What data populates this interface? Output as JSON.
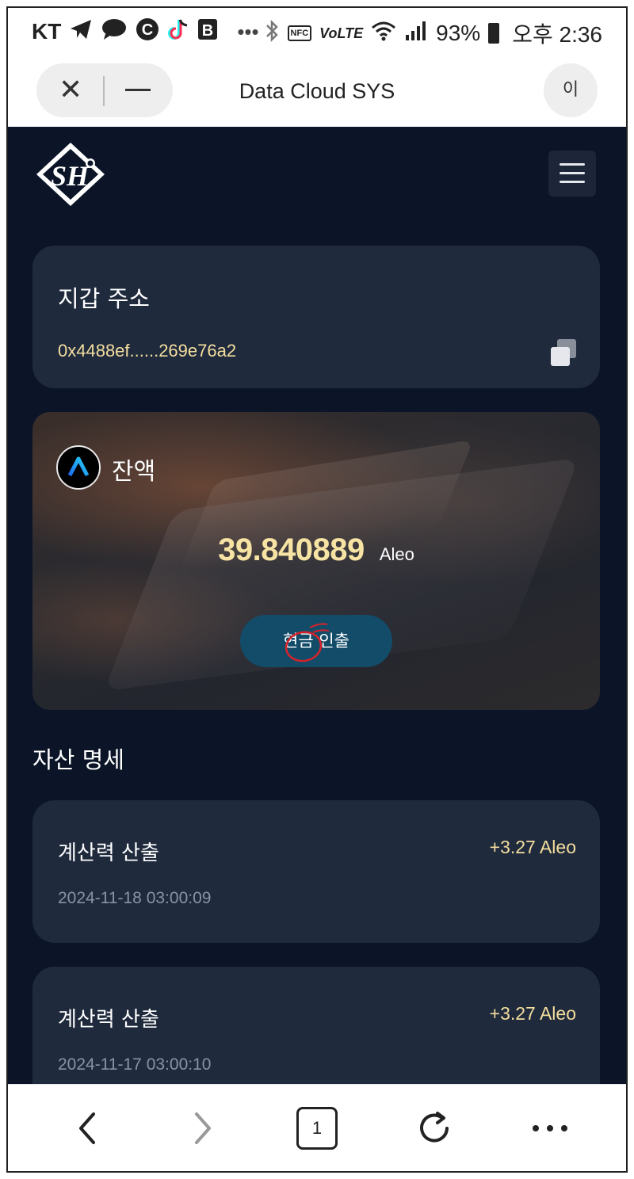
{
  "status_bar": {
    "carrier": "KT",
    "battery": "93%",
    "time": "오후 2:36",
    "icons": [
      "telegram-icon",
      "chat-icon",
      "c-app-icon",
      "tiktok-icon",
      "b-app-icon",
      "more-notifications-icon",
      "bluetooth-icon",
      "nfc-icon",
      "volte-icon",
      "wifi-icon",
      "signal-icon",
      "battery-icon"
    ],
    "nfc_label": "NFC",
    "volte_label": "VoLTE",
    "overflow": "•••"
  },
  "browser": {
    "title": "Data Cloud SYS",
    "profile_initial": "이"
  },
  "wallet": {
    "title": "지갑 주소",
    "address": "0x4488ef......269e76a2"
  },
  "balance": {
    "label": "잔액",
    "amount": "39.840889",
    "unit": "Aleo",
    "withdraw_label": "현금 인출"
  },
  "assets": {
    "title": "자산 명세",
    "transactions": [
      {
        "title": "계산력 산출",
        "amount": "+3.27 Aleo",
        "date": "2024-11-18 03:00:09"
      },
      {
        "title": "계산력 산출",
        "amount": "+3.27 Aleo",
        "date": "2024-11-17 03:00:10"
      }
    ]
  },
  "bottom_nav": {
    "tab_count": "1"
  },
  "colors": {
    "page_bg": "#0b1527",
    "card_bg": "#1f2a3d",
    "accent_gold": "#f5df9e",
    "button_bg": "#124c69"
  }
}
